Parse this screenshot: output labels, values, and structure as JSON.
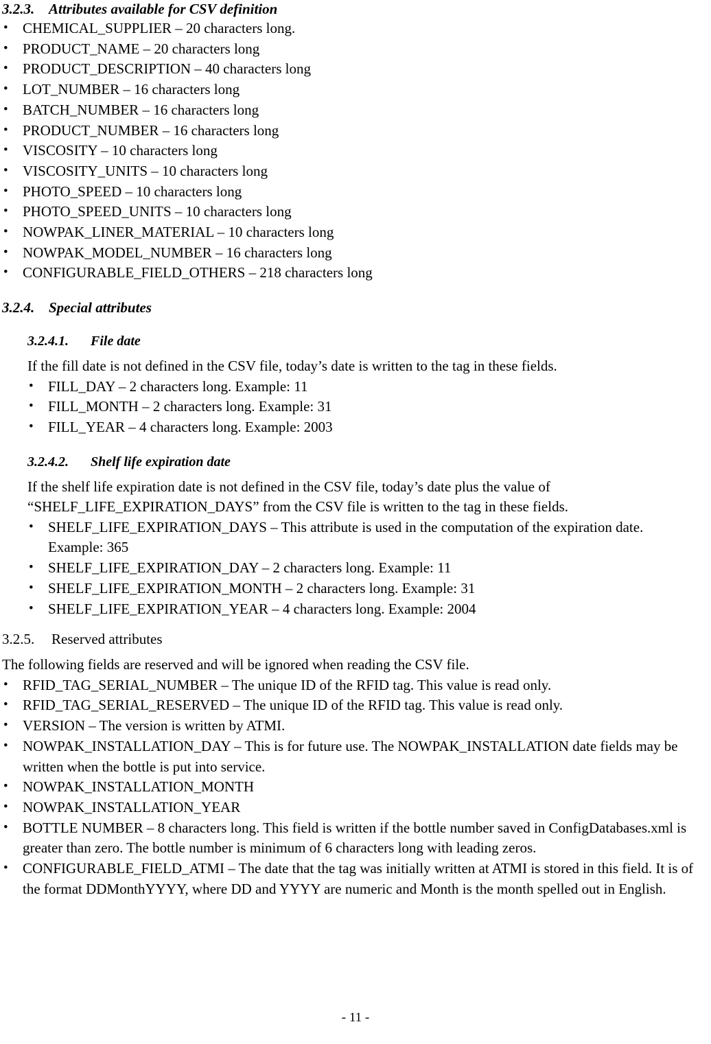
{
  "page": {
    "footer": "- 11 -"
  },
  "sections": {
    "csv_attributes": {
      "number": "3.2.3.",
      "title": "Attributes available for CSV definition",
      "items": [
        "CHEMICAL_SUPPLIER – 20 characters long.",
        "PRODUCT_NAME – 20 characters long",
        "PRODUCT_DESCRIPTION – 40 characters long",
        "LOT_NUMBER – 16 characters long",
        "BATCH_NUMBER – 16 characters long",
        "PRODUCT_NUMBER – 16 characters long",
        "VISCOSITY – 10 characters long",
        "VISCOSITY_UNITS – 10 characters long",
        "PHOTO_SPEED – 10 characters long",
        "PHOTO_SPEED_UNITS – 10 characters long",
        "NOWPAK_LINER_MATERIAL – 10 characters long",
        "NOWPAK_MODEL_NUMBER – 16 characters long",
        "CONFIGURABLE_FIELD_OTHERS – 218 characters long"
      ]
    },
    "special_attributes": {
      "number": "3.2.4.",
      "title": "Special attributes"
    },
    "file_date": {
      "number": "3.2.4.1.",
      "title": "File date",
      "intro": "If the fill date is not defined in the CSV file, today’s date is written to the tag in these fields.",
      "items": [
        "FILL_DAY – 2 characters long. Example: 11",
        "FILL_MONTH – 2 characters long. Example: 31",
        "FILL_YEAR – 4 characters long. Example: 2003"
      ]
    },
    "shelf_life": {
      "number": "3.2.4.2.",
      "title": "Shelf life expiration date",
      "intro": "If the shelf life expiration date is not defined in the CSV file, today’s date plus the value of “SHELF_LIFE_EXPIRATION_DAYS” from the CSV file is written to the tag in these fields.",
      "items": [
        "SHELF_LIFE_EXPIRATION_DAYS – This attribute is used in the computation of the expiration date. Example: 365",
        "SHELF_LIFE_EXPIRATION_DAY – 2 characters long. Example: 11",
        "SHELF_LIFE_EXPIRATION_MONTH – 2 characters long. Example: 31",
        "SHELF_LIFE_EXPIRATION_YEAR – 4 characters long. Example: 2004"
      ]
    },
    "reserved_attributes": {
      "number": "3.2.5.",
      "title": "Reserved attributes",
      "intro": "The following fields are reserved and will be ignored when reading the CSV file.",
      "items": [
        "RFID_TAG_SERIAL_NUMBER – The unique ID of the RFID tag. This value is read only.",
        "RFID_TAG_SERIAL_RESERVED – The unique ID of the RFID tag. This value is read only.",
        "VERSION – The version is written by ATMI.",
        "NOWPAK_INSTALLATION_DAY – This is for future use. The NOWPAK_INSTALLATION date fields may be written when the bottle is put into service.",
        "NOWPAK_INSTALLATION_MONTH",
        "NOWPAK_INSTALLATION_YEAR",
        "BOTTLE NUMBER – 8 characters long. This field is written if the bottle number saved in ConfigDatabases.xml is greater than zero. The bottle number is minimum of 6 characters long with leading zeros.",
        "CONFIGURABLE_FIELD_ATMI – The date that the tag was initially written at ATMI is stored in this field. It is of the format DDMonthYYYY, where DD and YYYY are numeric and Month is the month spelled out in English."
      ]
    }
  }
}
